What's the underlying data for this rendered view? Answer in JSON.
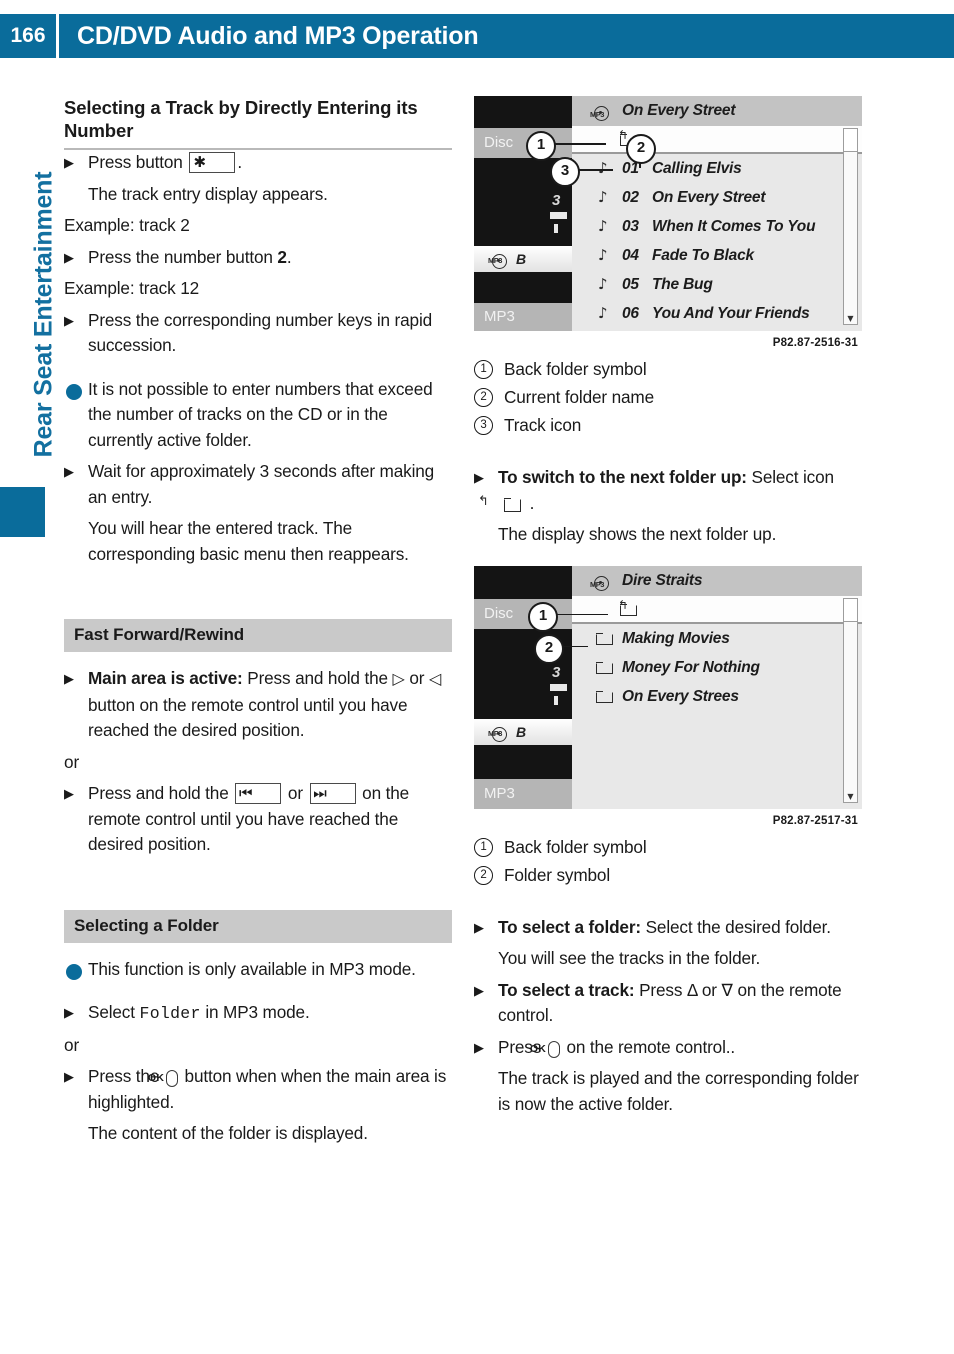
{
  "header": {
    "page_number": "166",
    "title": "CD/DVD Audio and MP3 Operation"
  },
  "side_tab": {
    "label": "Rear Seat Entertainment"
  },
  "left_column": {
    "section1": {
      "heading": "Selecting a Track by Directly Entering its Number",
      "step1_a": "Press button",
      "step1_key": "✱",
      "step1_b": ".",
      "step1_result": "The track entry display appears.",
      "example1": "Example: track 2",
      "step2_a": "Press the number button ",
      "step2_bold": "2",
      "step2_b": ".",
      "example2": "Example: track 12",
      "step3": "Press the corresponding number keys in rapid succession.",
      "note": "It is not possible to enter numbers that exceed the number of tracks on the CD or in the currently active folder.",
      "step4": "Wait for approximately 3 seconds after making an entry.",
      "step4_result": "You will hear the entered track. The corresponding basic menu then reappears."
    },
    "section2": {
      "heading": "Fast Forward/Rewind",
      "step1_bold": "Main area is active:",
      "step1_a": " Press and hold the",
      "step1_key1": "▷",
      "step1_mid": "or",
      "step1_key2": "◁",
      "step1_b": "button on the remote control until you have reached the desired position.",
      "or": "or",
      "step2_a": "Press and hold the",
      "step2_key1": "⏮",
      "step2_mid": "or",
      "step2_key2": "⏭",
      "step2_b": "on the remote control until you have reached the desired position."
    },
    "section3": {
      "heading": "Selecting a Folder",
      "note": "This function is only available in MP3 mode.",
      "step1_a": "Select ",
      "step1_mono": "Folder",
      "step1_b": " in MP3 mode.",
      "or": "or",
      "step2_a": "Press the",
      "step2_key": "OK",
      "step2_b": "button when when the main area is highlighted.",
      "step2_result": "The content of the folder is displayed."
    }
  },
  "right_column": {
    "figure1": {
      "caption": "P82.87-2516-31",
      "device": {
        "label_disc": "Disc",
        "label_mp3": "MP3",
        "white_row_text": "B",
        "number": "3"
      },
      "list_title": "On Every Street",
      "rows": [
        {
          "icon": "music-note-icon",
          "num": "01",
          "label": "Calling Elvis"
        },
        {
          "icon": "music-note-icon",
          "num": "02",
          "label": "On Every Street"
        },
        {
          "icon": "music-note-icon",
          "num": "03",
          "label": "When It Comes To You"
        },
        {
          "icon": "music-note-icon",
          "num": "04",
          "label": "Fade To Black"
        },
        {
          "icon": "music-note-icon",
          "num": "05",
          "label": "The Bug"
        },
        {
          "icon": "music-note-icon",
          "num": "06",
          "label": "You And Your Friends"
        }
      ],
      "callouts": [
        "1",
        "2",
        "3"
      ],
      "legend": [
        {
          "num": "1",
          "text": "Back folder symbol"
        },
        {
          "num": "2",
          "text": "Current folder name"
        },
        {
          "num": "3",
          "text": "Track icon"
        }
      ],
      "step_bold": "To switch to the next folder up:",
      "step_a": " Select icon",
      "step_b": ".",
      "step_result": "The display shows the next folder up."
    },
    "figure2": {
      "caption": "P82.87-2517-31",
      "device": {
        "label_disc": "Disc",
        "label_mp3": "MP3",
        "white_row_text": "B",
        "number": "3"
      },
      "list_title": "Dire Straits",
      "rows": [
        {
          "icon": "folder-icon",
          "label": "Making Movies"
        },
        {
          "icon": "folder-icon",
          "label": "Money For Nothing"
        },
        {
          "icon": "folder-icon",
          "label": "On Every Strees"
        }
      ],
      "callouts": [
        "1",
        "2"
      ],
      "legend": [
        {
          "num": "1",
          "text": "Back folder symbol"
        },
        {
          "num": "2",
          "text": "Folder symbol"
        }
      ],
      "step1_bold": "To select a folder:",
      "step1_a": " Select the desired folder.",
      "step1_result": "You will see the tracks in the folder.",
      "step2_bold": "To select a track:",
      "step2_a": " Press Δ or ∇ on the remote control.",
      "step3_a": "Press",
      "step3_key": "OK",
      "step3_b": "on the remote control..",
      "step3_result": "The track is played and the corresponding folder is now the active folder."
    }
  },
  "colors": {
    "header_blue": "#0a6c9b",
    "side_label_blue": "#1370a0",
    "gray_head": "#c9c9c9"
  }
}
